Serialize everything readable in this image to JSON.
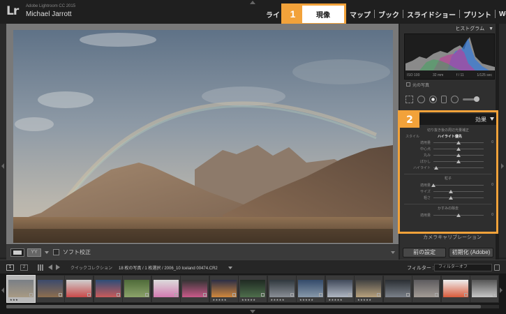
{
  "app": {
    "product": "Adobe Lightroom CC 2015",
    "user": "Michael Jarrott",
    "logo": "Lr"
  },
  "modules": {
    "library": "ライ",
    "develop_number": "1",
    "develop": "現像",
    "map": "マップ",
    "book": "ブック",
    "slideshow": "スライドショー",
    "print": "プリント",
    "web": "Web"
  },
  "toolbar": {
    "view_mode": "YY",
    "soft_proof": "ソフト校正"
  },
  "histogram": {
    "title": "ヒストグラム",
    "iso": "ISO 100",
    "focal": "32 mm",
    "aperture": "f / 11",
    "shutter": "1/125 sec",
    "original_photo": "元の写真"
  },
  "effects": {
    "number": "2",
    "title": "効果",
    "vignette_title": "切り抜き後の周辺光量補正",
    "style_label": "スタイル",
    "style_value": "ハイライト優先",
    "vignette_sliders": [
      {
        "label": "適用量",
        "value": "0",
        "pos": 0.5
      },
      {
        "label": "中心点",
        "value": "",
        "pos": 0.5
      },
      {
        "label": "丸み",
        "value": "",
        "pos": 0.5
      },
      {
        "label": "ぼかし",
        "value": "",
        "pos": 0.5
      },
      {
        "label": "ハイライト",
        "value": "",
        "pos": 0.05
      }
    ],
    "grain_title": "粒子",
    "grain_sliders": [
      {
        "label": "適用量",
        "value": "0",
        "pos": 0.0
      },
      {
        "label": "サイズ",
        "value": "",
        "pos": 0.35
      },
      {
        "label": "粗さ",
        "value": "",
        "pos": 0.35
      }
    ],
    "dehaze_title": "かすみの除去",
    "dehaze_sliders": [
      {
        "label": "適用量",
        "value": "0",
        "pos": 0.5
      }
    ]
  },
  "right_footer": {
    "camera_calibration": "カメラキャリブレーション",
    "previous": "前の設定",
    "reset": "初期化 (Adobe)"
  },
  "filmstrip": {
    "page1": "1",
    "page2": "2",
    "quick_collection": "クイックコレクション",
    "count": "18 枚の写真 / 1 枚選択 / 2006_10 Iceland 00474.CR2",
    "filter_label": "フィルター :",
    "filter_value": "フィルターオフ",
    "selected_stars": "★★★",
    "thumb_stars": "★★★★★"
  }
}
